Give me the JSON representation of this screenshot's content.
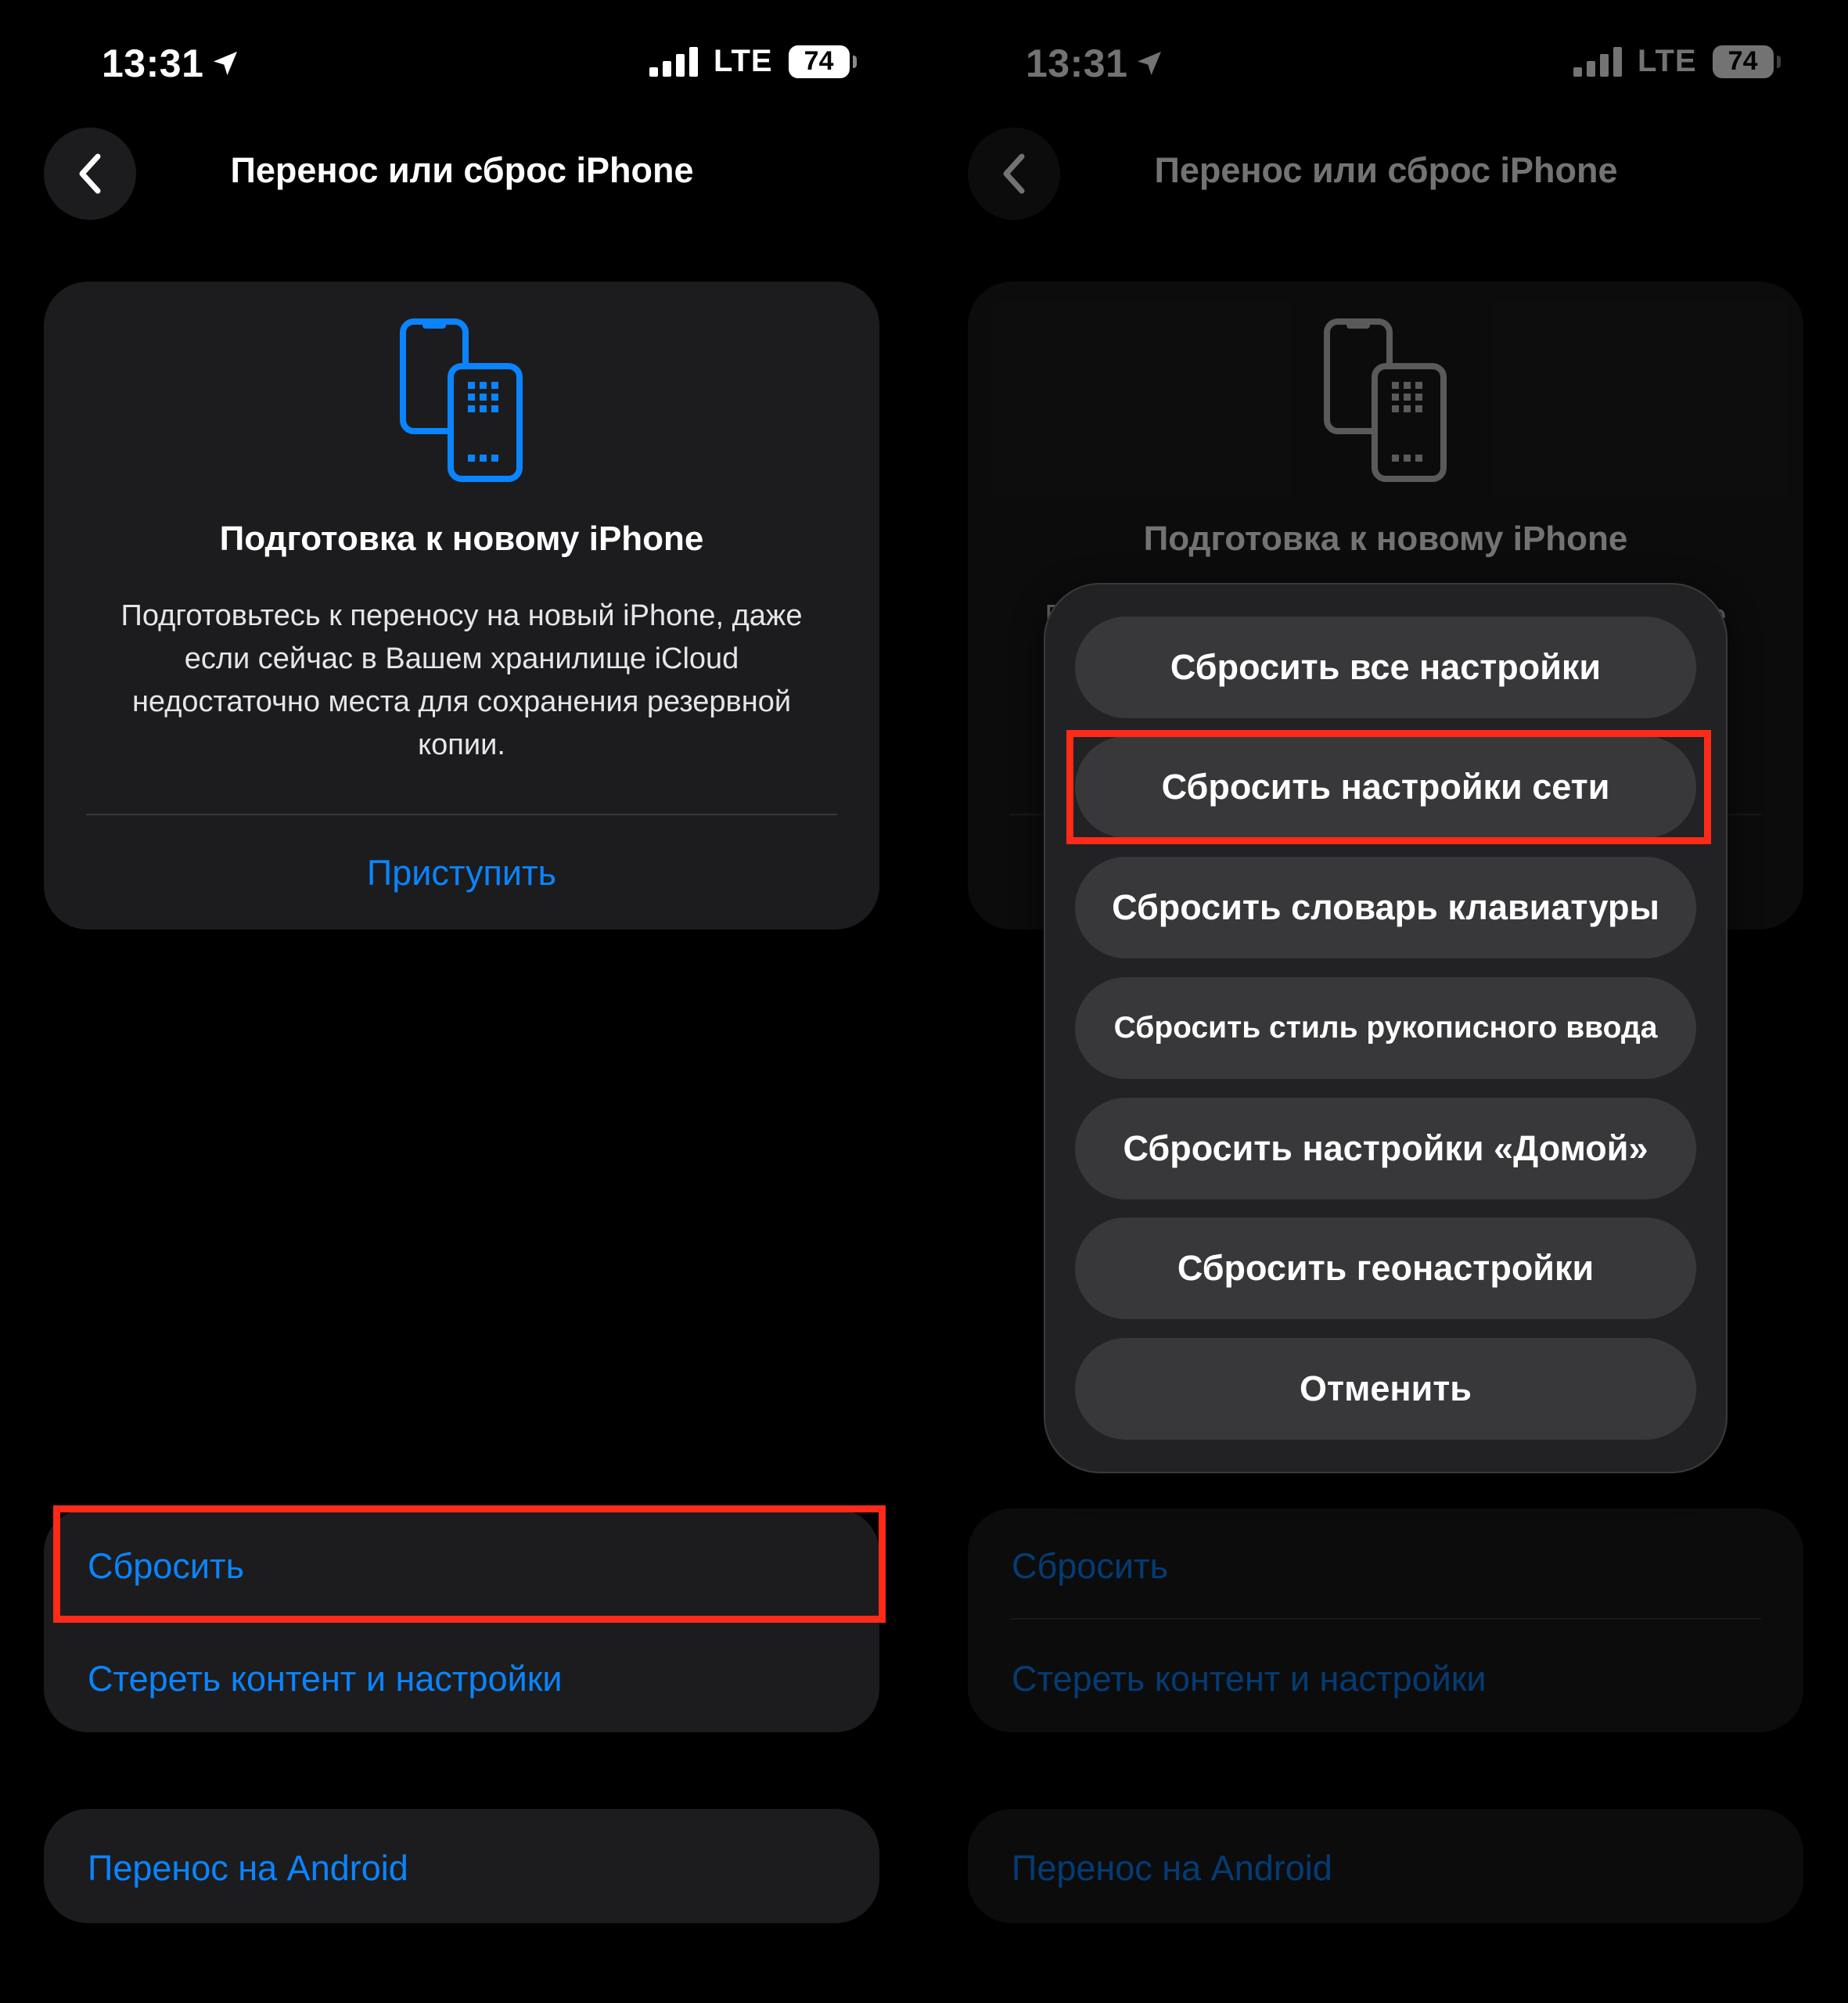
{
  "status": {
    "time": "13:31",
    "network": "LTE",
    "battery": "74"
  },
  "nav": {
    "title": "Перенос или сброс iPhone"
  },
  "prepare": {
    "title": "Подготовка к новому iPhone",
    "description": "Подготовьтесь к переносу на новый iPhone, даже если сейчас в Вашем хранилище iCloud недостаточно места для сохранения резервной копии.",
    "action": "Приступить"
  },
  "list": {
    "reset": "Сбросить",
    "erase": "Стереть контент и настройки",
    "android": "Перенос на Android"
  },
  "action_sheet": {
    "options": [
      "Сбросить все настройки",
      "Сбросить настройки сети",
      "Сбросить словарь клавиатуры",
      "Сбросить стиль рукописного ввода",
      "Сбросить настройки «Домой»",
      "Сбросить геонастройки"
    ],
    "cancel": "Отменить"
  },
  "colors": {
    "accent": "#0a84ff",
    "highlight": "#ff2a17",
    "card": "#1c1c1e",
    "sheet_button": "#38383a"
  },
  "icons": {
    "location": "location-arrow-icon",
    "signal": "cellular-signal-icon",
    "back": "chevron-left-icon",
    "prepare": "two-phones-icon"
  }
}
